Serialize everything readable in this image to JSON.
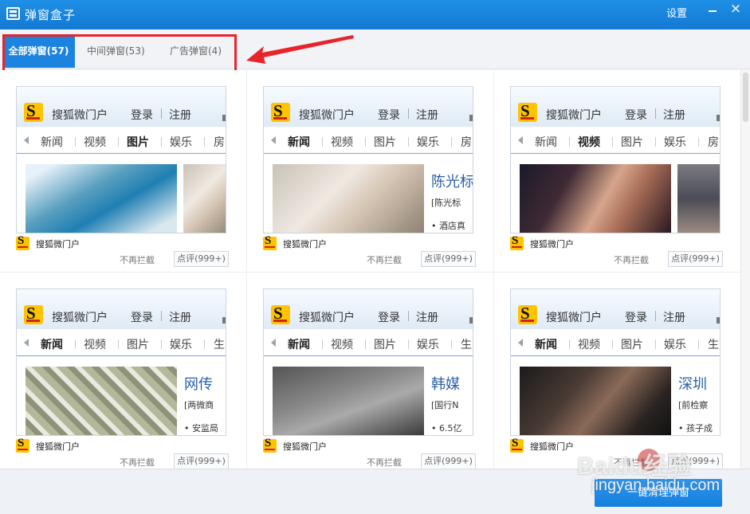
{
  "titlebar": {
    "title": "弹窗盒子",
    "settings": "设置",
    "close": "×"
  },
  "tabs": [
    {
      "label": "全部弹窗(57)",
      "active": true
    },
    {
      "label": "中间弹窗(53)",
      "active": false
    },
    {
      "label": "广告弹窗(4)",
      "active": false
    }
  ],
  "annotation": {
    "box_color": "#e8242a"
  },
  "preview": {
    "site_name": "搜狐微门户",
    "login": "登录",
    "register": "注册"
  },
  "cards": [
    {
      "nav": [
        "新闻",
        "视频",
        "图片",
        "娱乐",
        "房"
      ],
      "current": 2,
      "headline": "",
      "sub1": "",
      "sub2": ""
    },
    {
      "nav": [
        "新闻",
        "视频",
        "图片",
        "娱乐",
        "房"
      ],
      "current": 0,
      "headline": "陈光标",
      "sub1": "[陈光标",
      "sub2": "• 酒店真"
    },
    {
      "nav": [
        "新闻",
        "视频",
        "图片",
        "娱乐",
        "房"
      ],
      "current": 1,
      "headline": "",
      "sub1": "",
      "sub2": ""
    },
    {
      "nav": [
        "新闻",
        "视频",
        "图片",
        "娱乐",
        "生"
      ],
      "current": 0,
      "headline": "网传",
      "sub1": "[两微商",
      "sub2": "• 安监局"
    },
    {
      "nav": [
        "新闻",
        "视频",
        "图片",
        "娱乐",
        "生"
      ],
      "current": 0,
      "headline": "韩媒",
      "sub1": "[国行N",
      "sub2": "• 6.5亿"
    },
    {
      "nav": [
        "新闻",
        "视频",
        "图片",
        "娱乐",
        "生"
      ],
      "current": 0,
      "headline": "深圳",
      "sub1": "[前检察",
      "sub2": "• 孩子成"
    }
  ],
  "card_footer": {
    "name": "搜狐微门户",
    "unblock": "不再拦截",
    "comment": "点评(999+)"
  },
  "bottom": {
    "clean_button": "一键清理弹窗"
  },
  "watermark": {
    "text": "Baidu经验",
    "url": "jingyan.baidu.com"
  },
  "colors": {
    "accent": "#1c84df",
    "titlebar": "#1479d2",
    "link": "#2b5fa3"
  }
}
